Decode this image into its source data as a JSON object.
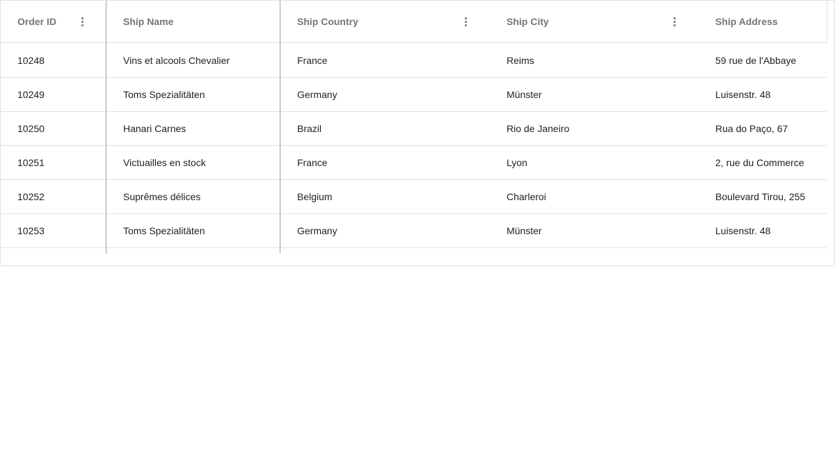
{
  "grid": {
    "columns": [
      {
        "key": "order_id",
        "label": "Order ID",
        "has_menu": true
      },
      {
        "key": "ship_name",
        "label": "Ship Name",
        "has_menu": false
      },
      {
        "key": "ship_country",
        "label": "Ship Country",
        "has_menu": true
      },
      {
        "key": "ship_city",
        "label": "Ship City",
        "has_menu": true
      },
      {
        "key": "ship_address",
        "label": "Ship Address",
        "has_menu": false
      }
    ],
    "rows": [
      [
        "10248",
        "Vins et alcools Chevalier",
        "France",
        "Reims",
        "59 rue de l'Abbaye"
      ],
      [
        "10249",
        "Toms Spezialitäten",
        "Germany",
        "Münster",
        "Luisenstr. 48"
      ],
      [
        "10250",
        "Hanari Carnes",
        "Brazil",
        "Rio de Janeiro",
        "Rua do Paço, 67"
      ],
      [
        "10251",
        "Victuailles en stock",
        "France",
        "Lyon",
        "2, rue du Commerce"
      ],
      [
        "10252",
        "Suprêmes délices",
        "Belgium",
        "Charleroi",
        "Boulevard Tirou, 255"
      ],
      [
        "10253",
        "Toms Spezialitäten",
        "Germany",
        "Münster",
        "Luisenstr. 48"
      ]
    ]
  },
  "icons": {
    "column_menu": "more-vert-icon"
  },
  "colors": {
    "header_text": "#757575",
    "cell_text": "#212121",
    "border": "#e0e0e0",
    "pinned_divider": "#9e9e9e"
  }
}
